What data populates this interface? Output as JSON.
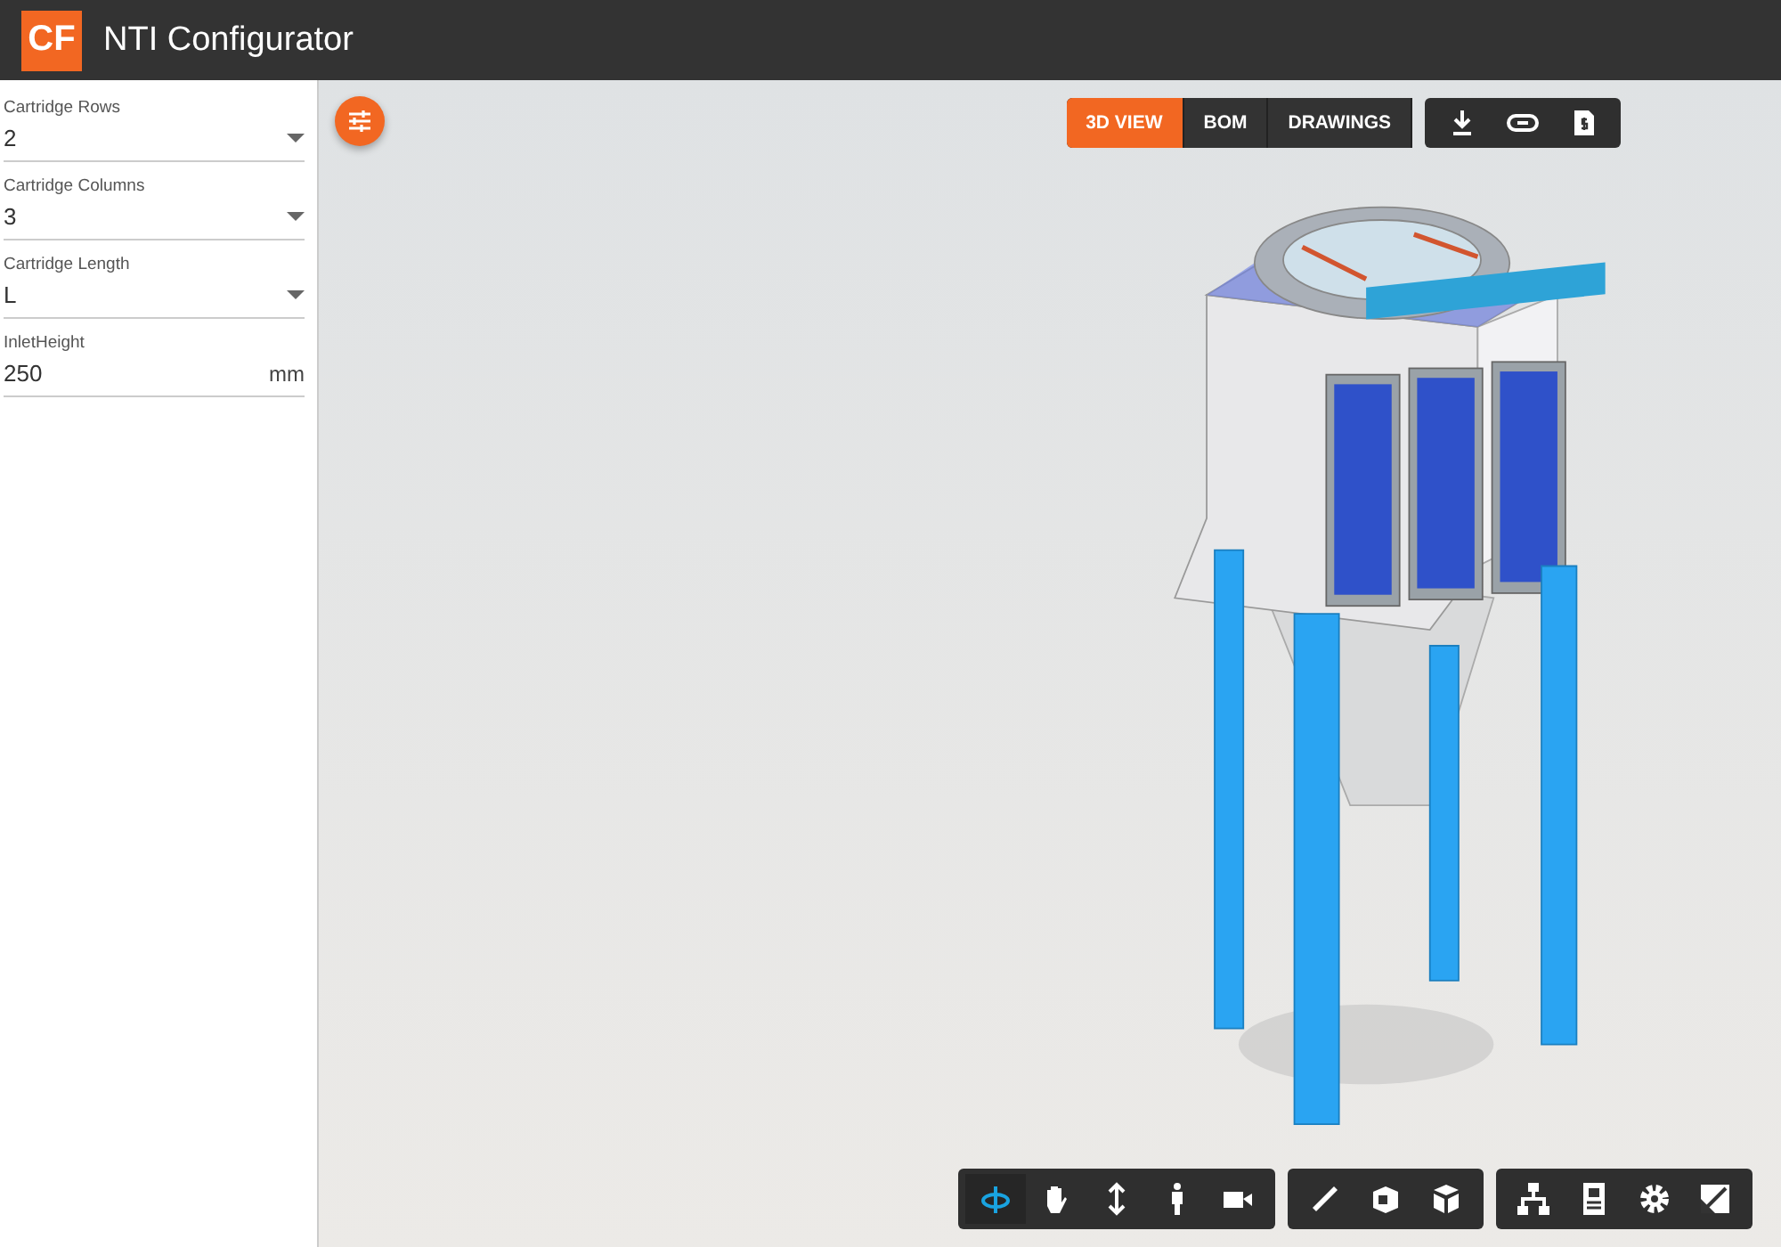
{
  "app": {
    "logo": "CF",
    "title": "NTI Configurator"
  },
  "fields": [
    {
      "kind": "select",
      "label": "Cartridge Rows",
      "value": "2"
    },
    {
      "kind": "select",
      "label": "Cartridge Columns",
      "value": "3"
    },
    {
      "kind": "select",
      "label": "Cartridge Length",
      "value": "L"
    },
    {
      "kind": "number",
      "label": "InletHeight",
      "value": "250",
      "unit": "mm"
    }
  ],
  "view_tabs": [
    {
      "label": "3D VIEW",
      "selected": true
    },
    {
      "label": "BOM",
      "selected": false
    },
    {
      "label": "DRAWINGS",
      "selected": false
    }
  ],
  "navigation_tools": [
    {
      "selected": true
    },
    {
      "selected": false
    },
    {
      "selected": false
    },
    {
      "selected": false
    },
    {
      "selected": false
    }
  ]
}
